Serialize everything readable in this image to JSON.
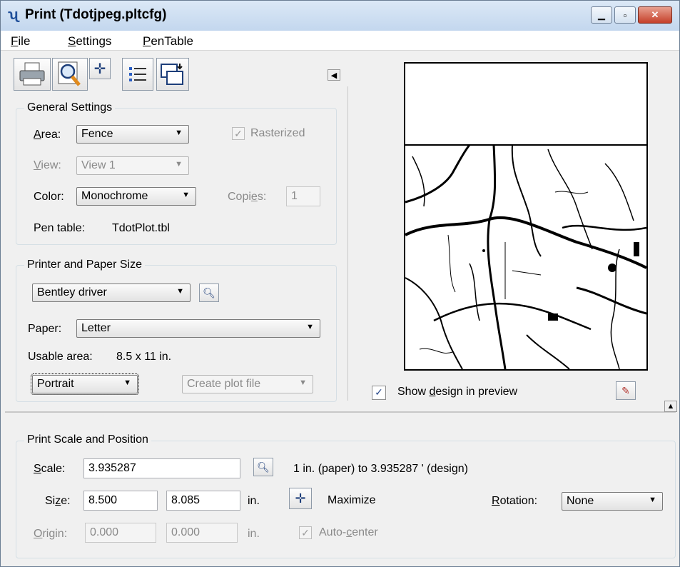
{
  "window": {
    "title": "Print  (Tdotjpeg.pltcfg)",
    "icon": "bentley-print-icon",
    "min_glyph": "▁",
    "max_glyph": "▫",
    "close_glyph": "✕"
  },
  "menu": [
    {
      "label": "File",
      "mnemonic": "F",
      "rest": "ile"
    },
    {
      "label": "Settings",
      "mnemonic": "S",
      "rest": "ettings"
    },
    {
      "label": "PenTable",
      "mnemonic": "P",
      "rest": "enTable"
    }
  ],
  "toolbar": {
    "icons": [
      "printer-icon",
      "preview-magnifier-icon",
      "maximize-fit-icon",
      "list-icon",
      "windows-page-icon"
    ]
  },
  "general": {
    "title": "General Settings",
    "area_label_m": "A",
    "area_label_rest": "rea:",
    "area_value": "Fence",
    "rasterized_label": "Rasterized",
    "rasterized_checked": true,
    "view_label_m": "V",
    "view_label_rest": "iew:",
    "view_value": "View 1",
    "color_label": "Color:",
    "color_value": "Monochrome",
    "copies_label_pre": "Copi",
    "copies_label_m": "e",
    "copies_label_post": "s:",
    "copies_value": "1",
    "pen_table_label": "Pen table:",
    "pen_table_value": "TdotPlot.tbl"
  },
  "printer": {
    "title": "Printer and Paper Size",
    "driver_value": "Bentley driver",
    "paper_label": "Paper:",
    "paper_value": "Letter",
    "usable_area_label": "Usable area:",
    "usable_area_value": "8.5 x 11 in.",
    "orientation_value": "Portrait",
    "output_value": "Create plot file"
  },
  "preview": {
    "show_design_pre": "Show ",
    "show_design_m": "d",
    "show_design_post": "esign in preview",
    "show_design_checked": true
  },
  "scale": {
    "title": "Print Scale and Position",
    "scale_label_m": "S",
    "scale_label_rest": "cale:",
    "scale_value": "3.935287",
    "scale_text": "1 in. (paper) to 3.935287 ' (design)",
    "size_label_pre": "Si",
    "size_label_m": "z",
    "size_label_post": "e:",
    "size_x": "8.500",
    "size_y": "8.085",
    "size_unit": "in.",
    "maximize_label": "Maximize",
    "rotation_label_m": "R",
    "rotation_label_rest": "otation:",
    "rotation_value": "None",
    "origin_label_m": "O",
    "origin_label_rest": "rigin:",
    "origin_x": "0.000",
    "origin_y": "0.000",
    "origin_unit": "in.",
    "autocenter_pre": "Auto-",
    "autocenter_m": "c",
    "autocenter_post": "enter",
    "autocenter_checked": true
  },
  "glyphs": {
    "dropdown": "▼",
    "check": "✓",
    "left_arrow": "◀",
    "up_arrow": "▲"
  }
}
